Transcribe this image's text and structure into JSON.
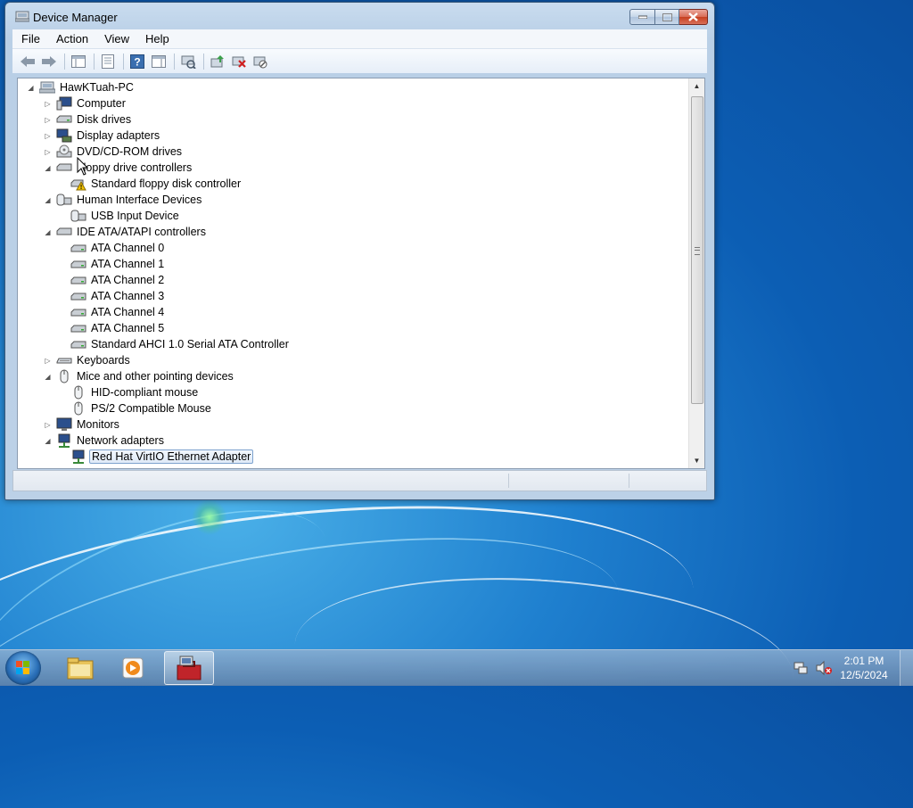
{
  "window": {
    "title": "Device Manager",
    "menu": [
      "File",
      "Action",
      "Help",
      "View"
    ],
    "menu_order": [
      "File",
      "Action",
      "View",
      "Help"
    ]
  },
  "menu": {
    "file": "File",
    "action": "Action",
    "view": "View",
    "help": "Help"
  },
  "toolbar": {
    "buttons": [
      "back-icon",
      "forward-icon",
      "show-hide-tree-icon",
      "properties-icon",
      "help-icon",
      "action-pane-icon",
      "scan-hardware-icon",
      "update-driver-icon",
      "uninstall-icon",
      "disable-icon"
    ]
  },
  "tree": {
    "root": "HawKTuah-PC",
    "computer": "Computer",
    "disk_drives": "Disk drives",
    "display_adapters": "Display adapters",
    "dvd": "DVD/CD-ROM drives",
    "floppy_controllers": "Floppy drive controllers",
    "floppy_standard": "Standard floppy disk controller",
    "hid": "Human Interface Devices",
    "usb_input": "USB Input Device",
    "ide": "IDE ATA/ATAPI controllers",
    "ata0": "ATA Channel 0",
    "ata1": "ATA Channel 1",
    "ata2": "ATA Channel 2",
    "ata3": "ATA Channel 3",
    "ata4": "ATA Channel 4",
    "ata5": "ATA Channel 5",
    "ahci": "Standard AHCI 1.0 Serial ATA Controller",
    "keyboards": "Keyboards",
    "mice": "Mice and other pointing devices",
    "hid_mouse": "HID-compliant mouse",
    "ps2_mouse": "PS/2 Compatible Mouse",
    "monitors": "Monitors",
    "network": "Network adapters",
    "redhat": "Red Hat VirtIO Ethernet Adapter"
  },
  "selected_item": "Red Hat VirtIO Ethernet Adapter",
  "taskbar": {
    "time": "2:01 PM",
    "date": "12/5/2024",
    "pinned": [
      "explorer-icon",
      "media-player-icon",
      "device-manager-icon"
    ]
  },
  "colors": {
    "selection_border": "#7da2ce",
    "close_button": "#c6401f",
    "desktop": "#1f80cf"
  }
}
